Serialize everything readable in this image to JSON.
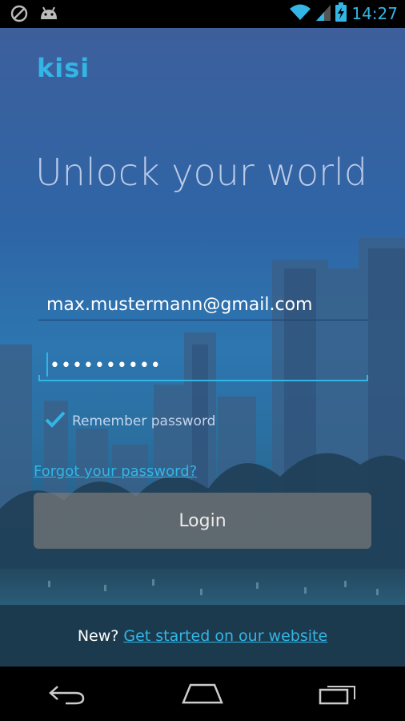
{
  "status_bar": {
    "time": "14:27",
    "icons": [
      "no-sim-icon",
      "android-debug-icon",
      "wifi-icon",
      "signal-icon",
      "battery-charging-icon"
    ]
  },
  "brand": {
    "logo_text": "kisi",
    "accent_color": "#33b5e5"
  },
  "headline": "Unlock your world",
  "login_form": {
    "email_value": "max.mustermann@gmail.com",
    "password_mask": "••••••••••",
    "remember_label": "Remember password",
    "remember_checked": true,
    "forgot_link": "Forgot your password?",
    "login_button": "Login"
  },
  "footer": {
    "prefix": "New?",
    "link_text": "Get started on our website"
  },
  "nav_bar": {
    "buttons": [
      "back-icon",
      "home-icon",
      "recents-icon"
    ]
  }
}
